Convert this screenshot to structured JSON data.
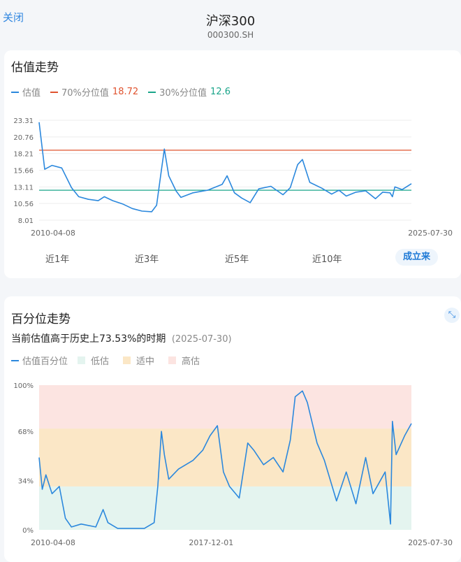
{
  "header": {
    "close_label": "关闭",
    "title": "沪深300",
    "code": "000300.SH"
  },
  "valuation": {
    "title": "估值走势",
    "legend": {
      "series": "估值",
      "p70_label": "70%分位值",
      "p70_value": "18.72",
      "p30_label": "30%分位值",
      "p30_value": "12.6"
    },
    "colors": {
      "series": "#2b88dd",
      "p70": "#e0532f",
      "p30": "#1aa58a"
    },
    "tabs": [
      {
        "label": "近1年",
        "active": false
      },
      {
        "label": "近3年",
        "active": false
      },
      {
        "label": "近5年",
        "active": false
      },
      {
        "label": "近10年",
        "active": false
      },
      {
        "label": "成立来",
        "active": true
      }
    ]
  },
  "percentile": {
    "title": "百分位走势",
    "expand_icon": "expand-icon",
    "description": "当前估值高于历史上73.53%的时期",
    "description_date": "(2025-07-30)",
    "legend": {
      "series": "估值百分位",
      "low": "低估",
      "mid": "适中",
      "high": "高估"
    },
    "colors": {
      "series": "#2b88dd",
      "low": "#e4f4ef",
      "mid": "#fbe7c6",
      "high": "#fce4e1"
    }
  },
  "chart_data": [
    {
      "type": "line",
      "name": "valuation",
      "x_range": [
        "2010-04-08",
        "2025-07-30"
      ],
      "xtick_labels": [
        "2010-04-08",
        "2025-07-30"
      ],
      "ytick_labels": [
        "23.31",
        "20.76",
        "18.21",
        "15.66",
        "13.11",
        "10.56",
        "8.01"
      ],
      "ylim": [
        8.01,
        23.31
      ],
      "reference_lines": [
        {
          "label": "70%分位值",
          "value": 18.72
        },
        {
          "label": "30%分位值",
          "value": 12.6
        }
      ],
      "series": [
        {
          "name": "估值",
          "x": [
            2010.27,
            2010.5,
            2010.8,
            2011.2,
            2011.6,
            2011.9,
            2012.3,
            2012.7,
            2012.95,
            2013.3,
            2013.7,
            2014.1,
            2014.5,
            2014.9,
            2015.1,
            2015.3,
            2015.42,
            2015.6,
            2015.9,
            2016.1,
            2016.6,
            2017.2,
            2017.8,
            2018.0,
            2018.3,
            2018.6,
            2018.95,
            2019.3,
            2019.8,
            2020.3,
            2020.6,
            2020.9,
            2021.1,
            2021.4,
            2021.9,
            2022.3,
            2022.6,
            2022.9,
            2023.3,
            2023.7,
            2024.1,
            2024.4,
            2024.7,
            2024.8,
            2024.9,
            2025.2,
            2025.58
          ],
          "y": [
            23.0,
            15.8,
            16.4,
            16.0,
            13.0,
            11.6,
            11.2,
            11.0,
            11.6,
            11.0,
            10.5,
            9.8,
            9.4,
            9.3,
            10.3,
            15.7,
            18.9,
            14.8,
            12.5,
            11.5,
            12.2,
            12.6,
            13.5,
            14.8,
            12.2,
            11.4,
            10.7,
            12.8,
            13.2,
            11.9,
            13.0,
            16.5,
            17.3,
            13.8,
            12.9,
            12.0,
            12.6,
            11.7,
            12.3,
            12.5,
            11.3,
            12.3,
            12.2,
            11.6,
            13.1,
            12.7,
            13.6
          ]
        }
      ]
    },
    {
      "type": "line",
      "name": "percentile",
      "x_range": [
        "2010-04-08",
        "2025-07-30"
      ],
      "xtick_labels": [
        "2010-04-08",
        "2017-12-01",
        "2025-07-30"
      ],
      "ytick_labels": [
        "100%",
        "68%",
        "34%",
        "0%"
      ],
      "ylim": [
        0,
        100
      ],
      "bands": [
        {
          "label": "低估",
          "from": 0,
          "to": 30
        },
        {
          "label": "适中",
          "from": 30,
          "to": 70
        },
        {
          "label": "高估",
          "from": 70,
          "to": 100
        }
      ],
      "series": [
        {
          "name": "估值百分位",
          "x": [
            2010.27,
            2010.4,
            2010.55,
            2010.8,
            2011.1,
            2011.35,
            2011.6,
            2012.0,
            2012.6,
            2012.9,
            2013.1,
            2013.5,
            2014.0,
            2014.6,
            2015.0,
            2015.15,
            2015.3,
            2015.42,
            2015.6,
            2016.0,
            2016.6,
            2017.0,
            2017.3,
            2017.6,
            2017.85,
            2018.1,
            2018.5,
            2018.85,
            2019.1,
            2019.5,
            2019.9,
            2020.3,
            2020.6,
            2020.8,
            2021.1,
            2021.3,
            2021.7,
            2022.0,
            2022.5,
            2022.9,
            2023.3,
            2023.7,
            2024.0,
            2024.5,
            2024.72,
            2024.8,
            2024.95,
            2025.3,
            2025.58
          ],
          "y": [
            50,
            28,
            38,
            25,
            30,
            8,
            2,
            4,
            2,
            14,
            5,
            1,
            1,
            1,
            5,
            30,
            68,
            52,
            35,
            42,
            48,
            55,
            65,
            72,
            40,
            30,
            22,
            60,
            55,
            45,
            50,
            40,
            62,
            92,
            96,
            88,
            60,
            48,
            20,
            40,
            18,
            50,
            25,
            40,
            4,
            75,
            52,
            65,
            73.5
          ]
        }
      ]
    }
  ]
}
